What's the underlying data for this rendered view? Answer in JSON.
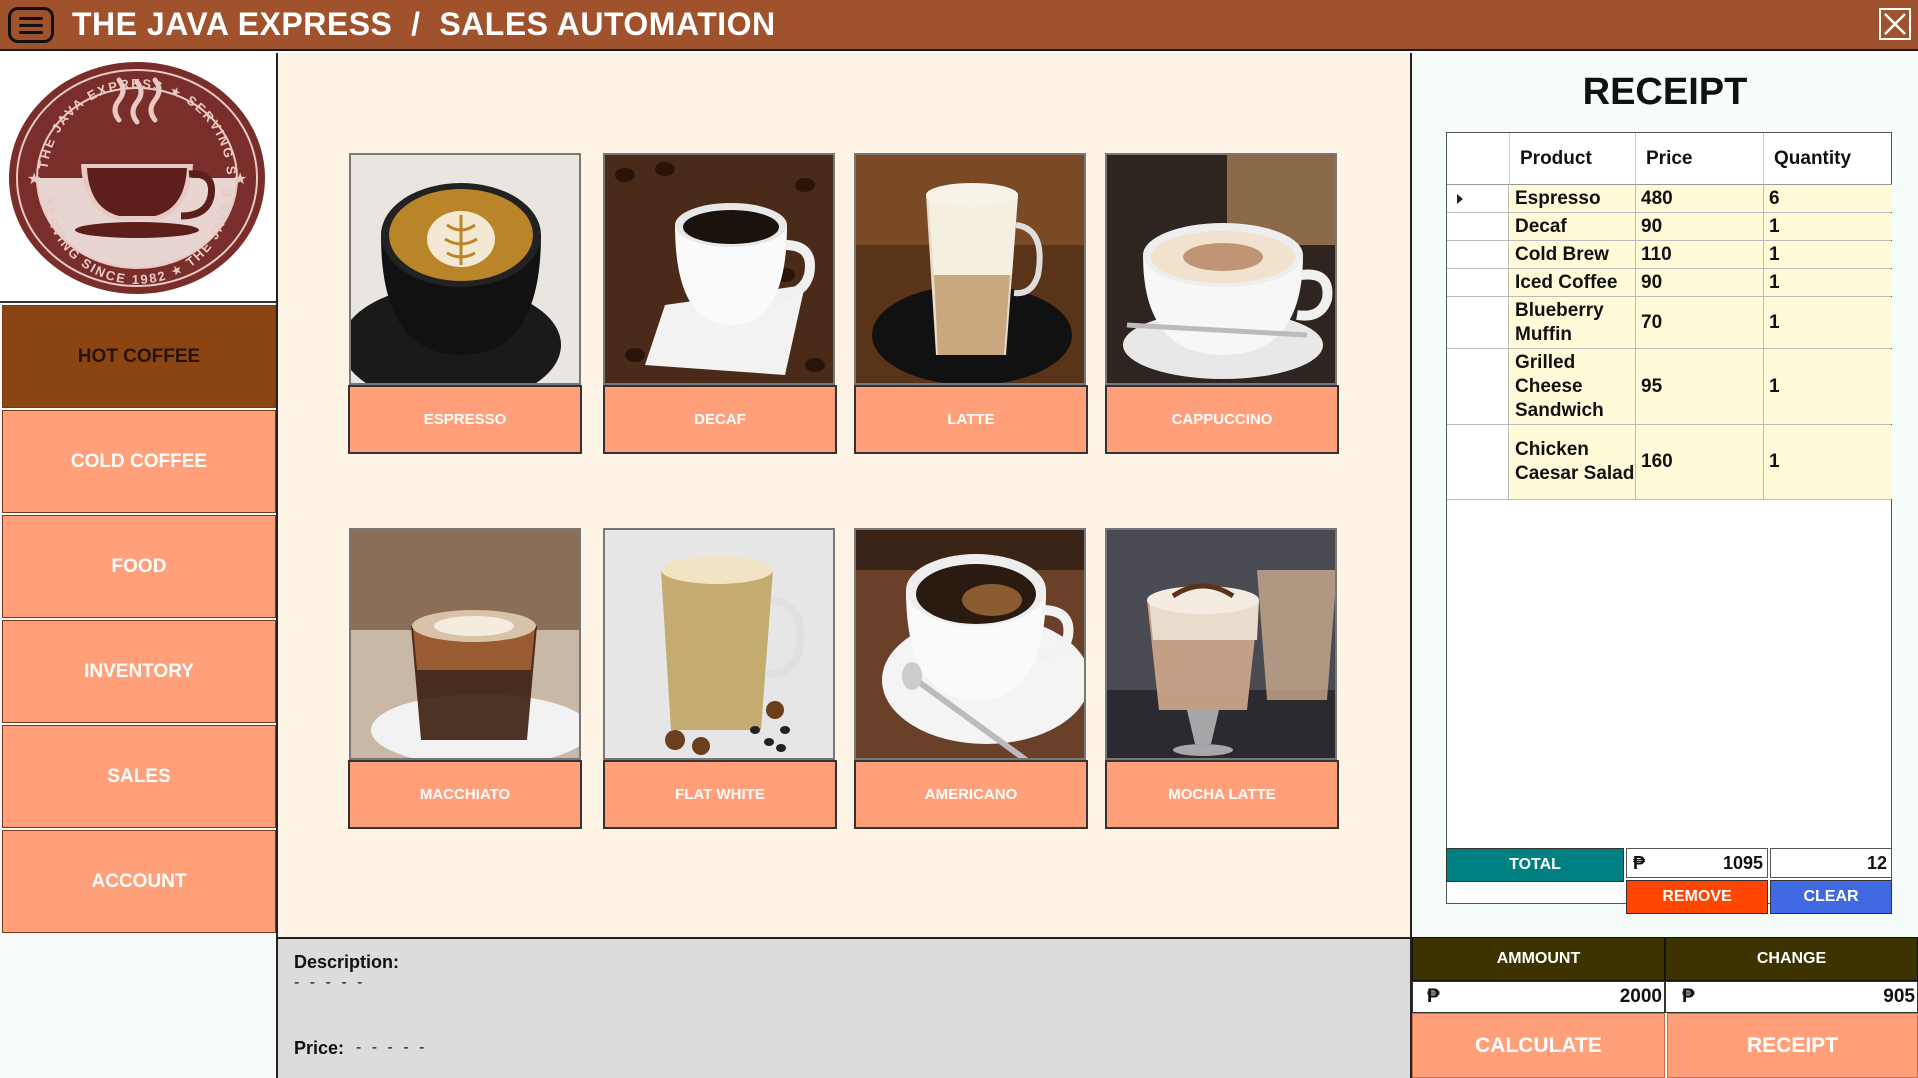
{
  "app": {
    "title": "THE JAVA EXPRESS  /  SALES AUTOMATION",
    "logo_text_top": "THE JAVA EXPRESS ★ SERVING SINCE 1982",
    "logo_text_bottom": "SERVING SINCE 1982 ★ THE JAVA EXPRESS"
  },
  "icons": {
    "menu": "menu-icon",
    "close": "close-icon",
    "logo": "coffee-cup-logo"
  },
  "colors": {
    "titlebar": "#a0522d",
    "nav_button": "#ffa07a",
    "nav_active": "#8b4513",
    "total": "#008080",
    "remove": "#ff4500",
    "clear": "#4169e1",
    "amount_header": "#3d3300"
  },
  "sidebar": {
    "items": [
      {
        "label": "HOT COFFEE",
        "active": true
      },
      {
        "label": "COLD COFFEE"
      },
      {
        "label": "FOOD"
      },
      {
        "label": "INVENTORY"
      },
      {
        "label": "SALES"
      },
      {
        "label": "ACCOUNT"
      }
    ]
  },
  "products": [
    {
      "label": "ESPRESSO"
    },
    {
      "label": "DECAF"
    },
    {
      "label": "LATTE"
    },
    {
      "label": "CAPPUCCINO"
    },
    {
      "label": "MACCHIATO"
    },
    {
      "label": "FLAT WHITE"
    },
    {
      "label": "AMERICANO"
    },
    {
      "label": "MOCHA LATTE"
    }
  ],
  "description": {
    "desc_label": "Description:",
    "desc_value": "- - - - -",
    "price_label": "Price:",
    "price_value": "- - - - -"
  },
  "receipt": {
    "title": "RECEIPT",
    "columns": [
      "Product",
      "Price",
      "Quantity"
    ],
    "rows": [
      {
        "product": "Espresso",
        "price": "480",
        "qty": "6"
      },
      {
        "product": "Decaf",
        "price": "90",
        "qty": "1"
      },
      {
        "product": "Cold Brew",
        "price": "110",
        "qty": "1"
      },
      {
        "product": "Iced Coffee",
        "price": "90",
        "qty": "1"
      },
      {
        "product": "Blueberry Muffin",
        "price": "70",
        "qty": "1"
      },
      {
        "product": "Grilled Cheese Sandwich",
        "price": "95",
        "qty": "1"
      },
      {
        "product": "Chicken Caesar Salad",
        "price": "160",
        "qty": "1"
      }
    ],
    "total_label": "TOTAL",
    "currency": "₱",
    "total_price": "1095",
    "total_qty": "12",
    "remove_label": "REMOVE",
    "clear_label": "CLEAR"
  },
  "payment": {
    "amount_label": "AMMOUNT",
    "change_label": "CHANGE",
    "amount_value": "2000",
    "change_value": "905",
    "calculate_label": "CALCULATE",
    "receipt_label": "RECEIPT"
  }
}
